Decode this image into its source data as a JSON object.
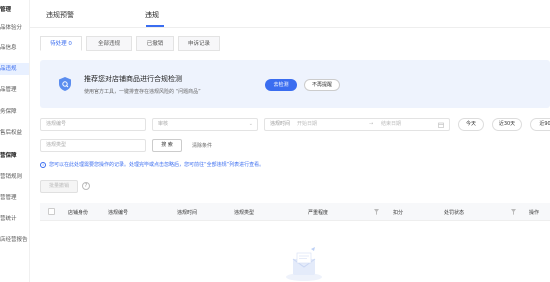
{
  "sidebar": {
    "items": [
      {
        "label": "管理",
        "type": "head"
      },
      {
        "label": "品体验分",
        "type": "item"
      },
      {
        "label": "品信息",
        "type": "item"
      },
      {
        "label": "品违规",
        "type": "active"
      },
      {
        "label": "品管理",
        "type": "item"
      },
      {
        "label": "务保障",
        "type": "item"
      },
      {
        "label": "售后权益",
        "type": "item"
      },
      {
        "label": "营保障",
        "type": "head"
      },
      {
        "label": "营销规则",
        "type": "item"
      },
      {
        "label": "营管理",
        "type": "item"
      },
      {
        "label": "营统计",
        "type": "item"
      },
      {
        "label": "店经营报告",
        "type": "item"
      }
    ]
  },
  "top_tabs": {
    "warning": "违规预警",
    "violation": "违规"
  },
  "sub_tabs": [
    {
      "label": "待处理 0",
      "active": true
    },
    {
      "label": "全部违规",
      "active": false
    },
    {
      "label": "已撤销",
      "active": false
    },
    {
      "label": "申诉记录",
      "active": false
    }
  ],
  "banner": {
    "title": "推荐您对店铺商品进行合规检测",
    "desc": "使用官方工具，一键排查存在违规风险的 “问题商品”",
    "primary_label": "去检测",
    "outline_label": "不再提醒"
  },
  "filters": {
    "violation_no_placeholder": "违规编号",
    "status_placeholder": "审核",
    "time_label": "违规时间",
    "start_placeholder": "开始日期",
    "separator": "→",
    "end_placeholder": "结束日期",
    "type_placeholder": "违规类型",
    "quick": [
      "今天",
      "近30天",
      "近90"
    ],
    "search_label": "搜 索",
    "clear_label": "清除条件"
  },
  "info_text": "您可以在此处理需要您操作的记录。处理完毕或点击忽略后，您可前往“全部违规”列表进行查看。",
  "batch_label": "批量撤销",
  "table": {
    "headers": [
      "店铺身份",
      "违规编号",
      "违规时间",
      "违规类型",
      "严重程度",
      "扣分",
      "处罚状态",
      "操作"
    ]
  },
  "colors": {
    "accent": "#3a6df0",
    "banner_bg": "#eef3fd"
  }
}
